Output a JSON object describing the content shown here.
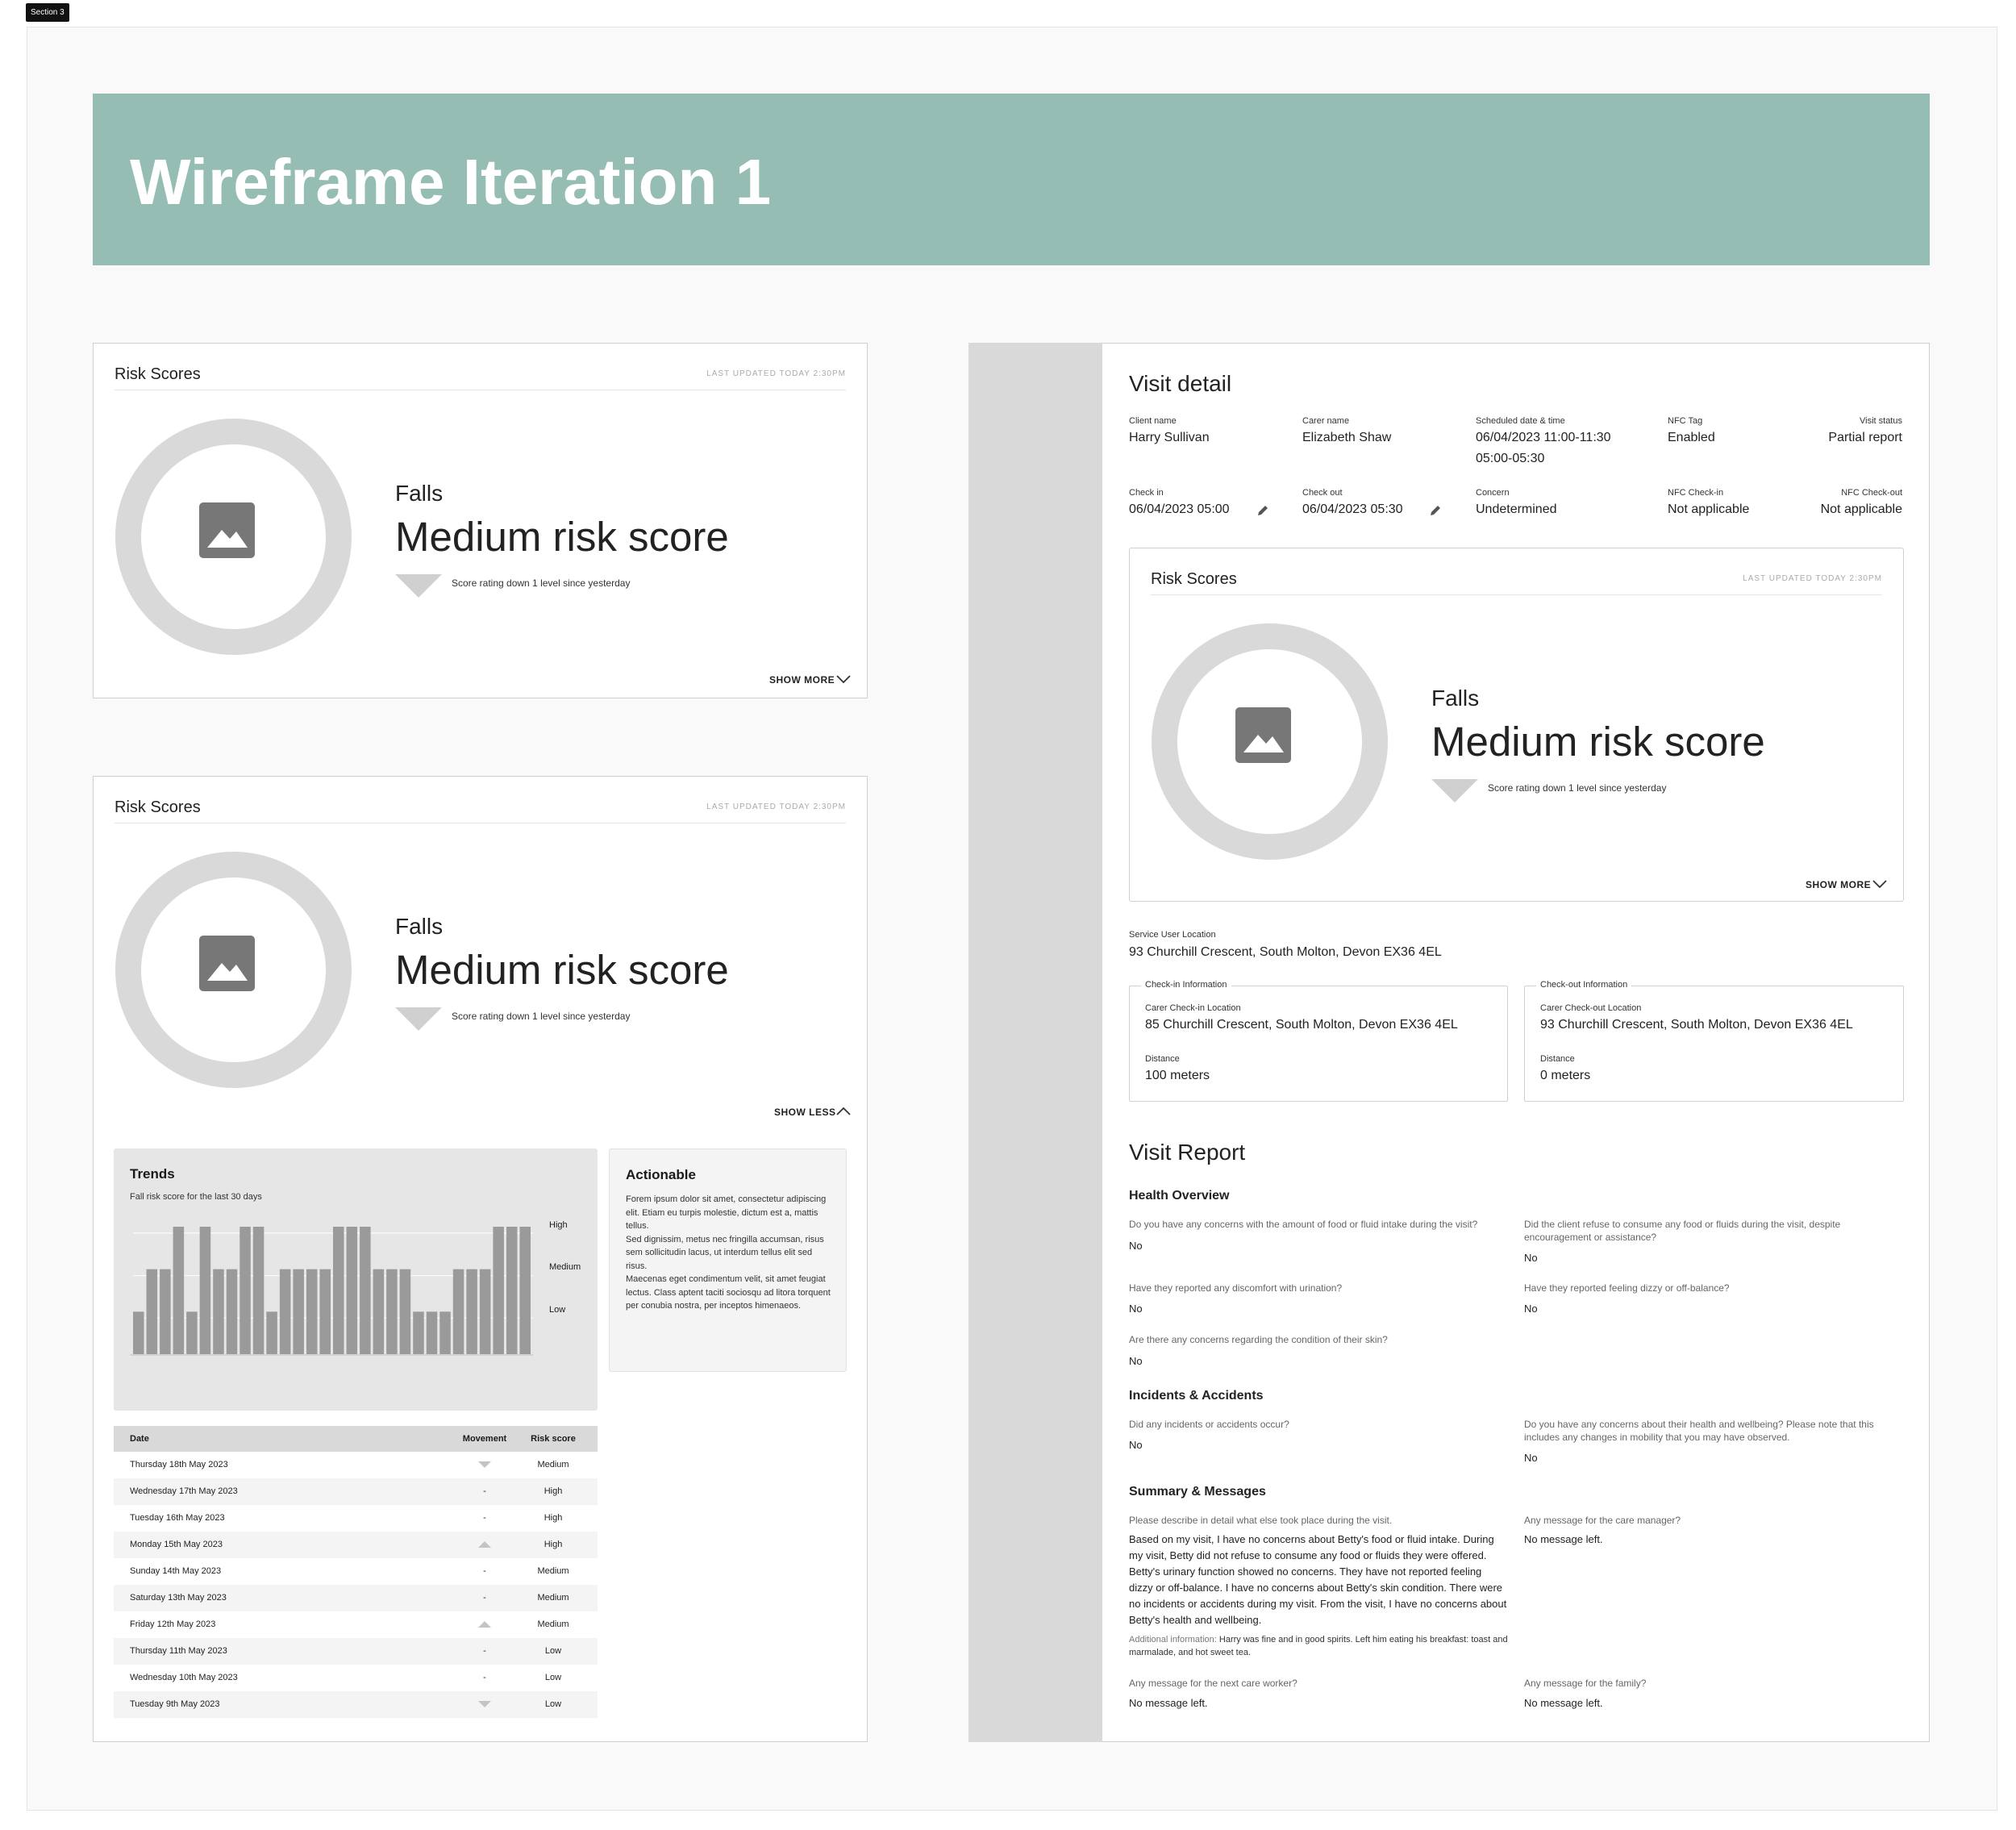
{
  "section_tag": "Section 3",
  "banner_title": "Wireframe Iteration 1",
  "risk_card": {
    "title": "Risk Scores",
    "updated": "LAST UPDATED TODAY 2:30PM",
    "category": "Falls",
    "score_label": "Medium risk score",
    "delta_text": "Score rating down 1 level since yesterday",
    "show_more": "SHOW MORE",
    "show_less": "SHOW LESS"
  },
  "trends": {
    "title": "Trends",
    "subtitle": "Fall risk score for the last 30 days",
    "levels": [
      "High",
      "Medium",
      "Low"
    ]
  },
  "chart_data": {
    "type": "bar",
    "title": "Fall risk score for the last 30 days",
    "levels": [
      "Low",
      "Medium",
      "High"
    ],
    "values": [
      1,
      2,
      2,
      3,
      1,
      3,
      2,
      2,
      3,
      3,
      1,
      2,
      2,
      2,
      2,
      3,
      3,
      3,
      2,
      2,
      2,
      1,
      1,
      1,
      2,
      2,
      2,
      3,
      3,
      3
    ],
    "ylim": [
      0,
      3
    ]
  },
  "actionable": {
    "title": "Actionable",
    "body": "Forem ipsum dolor sit amet, consectetur adipiscing elit. Etiam eu turpis molestie, dictum est a, mattis tellus.\nSed dignissim, metus nec fringilla accumsan, risus sem sollicitudin lacus, ut interdum tellus elit sed risus.\nMaecenas eget condimentum velit, sit amet feugiat lectus. Class aptent taciti sociosqu ad litora torquent per conubia nostra, per inceptos himenaeos."
  },
  "table": {
    "headers": [
      "Date",
      "Movement",
      "Risk score"
    ],
    "rows": [
      {
        "date": "Thursday 18th May 2023",
        "movement": "down",
        "score": "Medium"
      },
      {
        "date": "Wednesday 17th May 2023",
        "movement": "-",
        "score": "High"
      },
      {
        "date": "Tuesday 16th May 2023",
        "movement": "-",
        "score": "High"
      },
      {
        "date": "Monday 15th May 2023",
        "movement": "up",
        "score": "High"
      },
      {
        "date": "Sunday 14th May 2023",
        "movement": "-",
        "score": "Medium"
      },
      {
        "date": "Saturday 13th May 2023",
        "movement": "-",
        "score": "Medium"
      },
      {
        "date": "Friday 12th May 2023",
        "movement": "up",
        "score": "Medium"
      },
      {
        "date": "Thursday 11th May 2023",
        "movement": "-",
        "score": "Low"
      },
      {
        "date": "Wednesday 10th May 2023",
        "movement": "-",
        "score": "Low"
      },
      {
        "date": "Tuesday 9th May 2023",
        "movement": "down",
        "score": "Low"
      }
    ]
  },
  "visit": {
    "title": "Visit detail",
    "client_label": "Client name",
    "client": "Harry Sullivan",
    "carer_label": "Carer name",
    "carer": "Elizabeth Shaw",
    "sched_label": "Scheduled date & time",
    "sched_line1": "06/04/2023  11:00-11:30",
    "sched_line2": "05:00-05:30",
    "nfc_tag_label": "NFC Tag",
    "nfc_tag": "Enabled",
    "status_label": "Visit status",
    "status": "Partial report",
    "checkin_label": "Check in",
    "checkin": "06/04/2023 05:00",
    "checkout_label": "Check out",
    "checkout": "06/04/2023 05:30",
    "concern_label": "Concern",
    "concern": "Undetermined",
    "nfc_in_label": "NFC Check-in",
    "nfc_in": "Not applicable",
    "nfc_out_label": "NFC Check-out",
    "nfc_out": "Not applicable",
    "location_label": "Service User Location",
    "location": "93 Churchill Crescent, South Molton, Devon EX36 4EL",
    "checkin_info": {
      "legend": "Check-in Information",
      "loc_label": "Carer Check-in Location",
      "loc": "85 Churchill Crescent, South Molton, Devon EX36 4EL",
      "dist_label": "Distance",
      "dist": "100 meters"
    },
    "checkout_info": {
      "legend": "Check-out Information",
      "loc_label": "Carer Check-out Location",
      "loc": "93 Churchill Crescent, South Molton, Devon EX36 4EL",
      "dist_label": "Distance",
      "dist": "0 meters"
    }
  },
  "report": {
    "title": "Visit Report",
    "health": "Health Overview",
    "q1": "Do you have any concerns with the amount of food or fluid intake during the visit?",
    "a1": "No",
    "q2": "Did the client refuse to consume any food or fluids during the visit, despite encouragement or assistance?",
    "a2": "No",
    "q3": "Have they reported any discomfort with urination?",
    "a3": "No",
    "q4": "Have they reported feeling dizzy or off-balance?",
    "a4": "No",
    "q5": "Are there any concerns regarding the condition of their skin?",
    "a5": "No",
    "incidents": "Incidents & Accidents",
    "q6": "Did any incidents or accidents occur?",
    "a6": "No",
    "q7": "Do you have any concerns about their health and wellbeing? Please note that this includes any changes in mobility that you may have observed.",
    "a7": "No",
    "summary": "Summary & Messages",
    "q8": "Please describe in detail what else took place during the visit.",
    "a8": "Based on my visit, I have no concerns about Betty's food or fluid intake. During my visit, Betty did not refuse to consume any food or fluids they were offered. Betty's urinary function showed no concerns. They have not reported feeling dizzy or off-balance. I have no concerns about Betty's skin condition. There were no incidents or accidents during my visit. From the visit, I have no concerns about Betty's health and wellbeing.",
    "additional_label": "Additional information:",
    "additional": "Harry was fine and in good spirits. Left him eating his breakfast: toast and marmalade, and hot sweet tea.",
    "q9": "Any message for the care manager?",
    "a9": "No message left.",
    "q10": "Any message for the next care worker?",
    "a10": "No message left.",
    "q11": "Any message for the family?",
    "a11": "No message left."
  }
}
